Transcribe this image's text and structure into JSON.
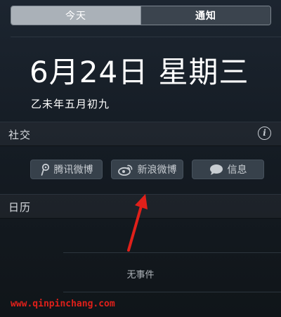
{
  "tabs": [
    {
      "label": "今天",
      "active": false
    },
    {
      "label": "通知",
      "active": true
    }
  ],
  "today": {
    "date": "6月24日 星期三",
    "lunar": "乙未年五月初九"
  },
  "social": {
    "title": "社交",
    "info_icon": "info-icon",
    "buttons": [
      {
        "label": "腾讯微博",
        "icon": "tencent-weibo-icon"
      },
      {
        "label": "新浪微博",
        "icon": "sina-weibo-icon"
      },
      {
        "label": "信息",
        "icon": "message-bubble-icon"
      }
    ]
  },
  "calendar": {
    "title": "日历",
    "empty_text": "无事件"
  },
  "watermark": "www.qinpinchang.com",
  "colors": {
    "arrow": "#e0201a",
    "background": "#151c24",
    "active_tab": "#3b444e",
    "inactive_tab": "#aab1b8"
  }
}
